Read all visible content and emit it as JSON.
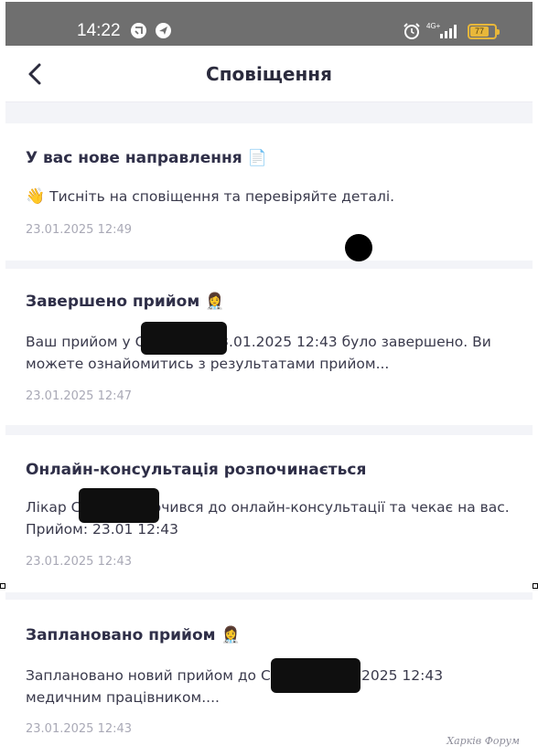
{
  "statusbar": {
    "time": "14:22",
    "network": "4G+",
    "battery": "77",
    "battery_level": 0.77,
    "icons": [
      "cast-icon",
      "navigation-icon",
      "alarm-icon",
      "signal-icon",
      "battery-icon"
    ]
  },
  "header": {
    "back_icon": "chevron-left-icon",
    "title": "Сповіщення"
  },
  "notifications": [
    {
      "title": "У вас нове направлення",
      "title_emoji": "📄",
      "body_emoji": "👋",
      "body": "Тисніть на сповіщення та перевіряйте деталі.",
      "time": "23.01.2025 12:49"
    },
    {
      "title": "Завершено прийом",
      "title_emoji": "👩‍⚕️",
      "body": "Ваш прийом у С          Д. В. на 23.01.2025 12:43 було завершено. Ви можете ознайомитись з результатами прийом...",
      "time": "23.01.2025 12:47"
    },
    {
      "title": "Онлайн-консультація розпочинається",
      "title_emoji": "",
      "body": "Лікар С          .В. підключився до онлайн-консультації та чекає на вас. Прийом: 23.01 12:43",
      "time": "23.01.2025 12:43"
    },
    {
      "title": "Заплановано прийом",
      "title_emoji": "👩‍⚕️",
      "body": "Заплановано новий прийом до С          В. на 23.01.2025 12:43 медичним працівником....",
      "time": "23.01.2025 12:43"
    }
  ],
  "watermark": "Харків Форум",
  "colors": {
    "statusbar": "#6f6f6f",
    "background": "#f3f4f8",
    "title_text": "#2f2f48",
    "time_text": "#a9a9b6",
    "battery": "#e8b73a"
  }
}
